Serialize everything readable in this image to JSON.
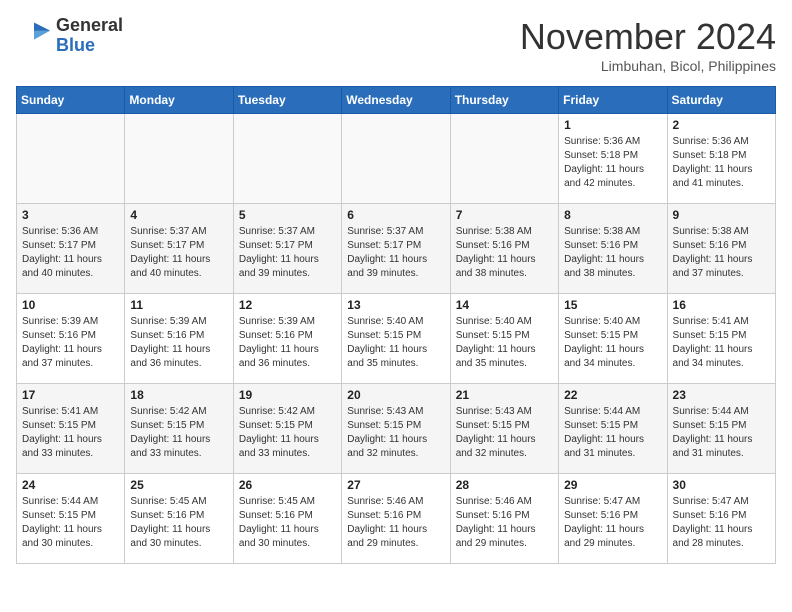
{
  "header": {
    "logo_general": "General",
    "logo_blue": "Blue",
    "month_title": "November 2024",
    "location": "Limbuhan, Bicol, Philippines"
  },
  "weekdays": [
    "Sunday",
    "Monday",
    "Tuesday",
    "Wednesday",
    "Thursday",
    "Friday",
    "Saturday"
  ],
  "weeks": [
    [
      {
        "day": "",
        "info": ""
      },
      {
        "day": "",
        "info": ""
      },
      {
        "day": "",
        "info": ""
      },
      {
        "day": "",
        "info": ""
      },
      {
        "day": "",
        "info": ""
      },
      {
        "day": "1",
        "info": "Sunrise: 5:36 AM\nSunset: 5:18 PM\nDaylight: 11 hours\nand 42 minutes."
      },
      {
        "day": "2",
        "info": "Sunrise: 5:36 AM\nSunset: 5:18 PM\nDaylight: 11 hours\nand 41 minutes."
      }
    ],
    [
      {
        "day": "3",
        "info": "Sunrise: 5:36 AM\nSunset: 5:17 PM\nDaylight: 11 hours\nand 40 minutes."
      },
      {
        "day": "4",
        "info": "Sunrise: 5:37 AM\nSunset: 5:17 PM\nDaylight: 11 hours\nand 40 minutes."
      },
      {
        "day": "5",
        "info": "Sunrise: 5:37 AM\nSunset: 5:17 PM\nDaylight: 11 hours\nand 39 minutes."
      },
      {
        "day": "6",
        "info": "Sunrise: 5:37 AM\nSunset: 5:17 PM\nDaylight: 11 hours\nand 39 minutes."
      },
      {
        "day": "7",
        "info": "Sunrise: 5:38 AM\nSunset: 5:16 PM\nDaylight: 11 hours\nand 38 minutes."
      },
      {
        "day": "8",
        "info": "Sunrise: 5:38 AM\nSunset: 5:16 PM\nDaylight: 11 hours\nand 38 minutes."
      },
      {
        "day": "9",
        "info": "Sunrise: 5:38 AM\nSunset: 5:16 PM\nDaylight: 11 hours\nand 37 minutes."
      }
    ],
    [
      {
        "day": "10",
        "info": "Sunrise: 5:39 AM\nSunset: 5:16 PM\nDaylight: 11 hours\nand 37 minutes."
      },
      {
        "day": "11",
        "info": "Sunrise: 5:39 AM\nSunset: 5:16 PM\nDaylight: 11 hours\nand 36 minutes."
      },
      {
        "day": "12",
        "info": "Sunrise: 5:39 AM\nSunset: 5:16 PM\nDaylight: 11 hours\nand 36 minutes."
      },
      {
        "day": "13",
        "info": "Sunrise: 5:40 AM\nSunset: 5:15 PM\nDaylight: 11 hours\nand 35 minutes."
      },
      {
        "day": "14",
        "info": "Sunrise: 5:40 AM\nSunset: 5:15 PM\nDaylight: 11 hours\nand 35 minutes."
      },
      {
        "day": "15",
        "info": "Sunrise: 5:40 AM\nSunset: 5:15 PM\nDaylight: 11 hours\nand 34 minutes."
      },
      {
        "day": "16",
        "info": "Sunrise: 5:41 AM\nSunset: 5:15 PM\nDaylight: 11 hours\nand 34 minutes."
      }
    ],
    [
      {
        "day": "17",
        "info": "Sunrise: 5:41 AM\nSunset: 5:15 PM\nDaylight: 11 hours\nand 33 minutes."
      },
      {
        "day": "18",
        "info": "Sunrise: 5:42 AM\nSunset: 5:15 PM\nDaylight: 11 hours\nand 33 minutes."
      },
      {
        "day": "19",
        "info": "Sunrise: 5:42 AM\nSunset: 5:15 PM\nDaylight: 11 hours\nand 33 minutes."
      },
      {
        "day": "20",
        "info": "Sunrise: 5:43 AM\nSunset: 5:15 PM\nDaylight: 11 hours\nand 32 minutes."
      },
      {
        "day": "21",
        "info": "Sunrise: 5:43 AM\nSunset: 5:15 PM\nDaylight: 11 hours\nand 32 minutes."
      },
      {
        "day": "22",
        "info": "Sunrise: 5:44 AM\nSunset: 5:15 PM\nDaylight: 11 hours\nand 31 minutes."
      },
      {
        "day": "23",
        "info": "Sunrise: 5:44 AM\nSunset: 5:15 PM\nDaylight: 11 hours\nand 31 minutes."
      }
    ],
    [
      {
        "day": "24",
        "info": "Sunrise: 5:44 AM\nSunset: 5:15 PM\nDaylight: 11 hours\nand 30 minutes."
      },
      {
        "day": "25",
        "info": "Sunrise: 5:45 AM\nSunset: 5:16 PM\nDaylight: 11 hours\nand 30 minutes."
      },
      {
        "day": "26",
        "info": "Sunrise: 5:45 AM\nSunset: 5:16 PM\nDaylight: 11 hours\nand 30 minutes."
      },
      {
        "day": "27",
        "info": "Sunrise: 5:46 AM\nSunset: 5:16 PM\nDaylight: 11 hours\nand 29 minutes."
      },
      {
        "day": "28",
        "info": "Sunrise: 5:46 AM\nSunset: 5:16 PM\nDaylight: 11 hours\nand 29 minutes."
      },
      {
        "day": "29",
        "info": "Sunrise: 5:47 AM\nSunset: 5:16 PM\nDaylight: 11 hours\nand 29 minutes."
      },
      {
        "day": "30",
        "info": "Sunrise: 5:47 AM\nSunset: 5:16 PM\nDaylight: 11 hours\nand 28 minutes."
      }
    ]
  ]
}
